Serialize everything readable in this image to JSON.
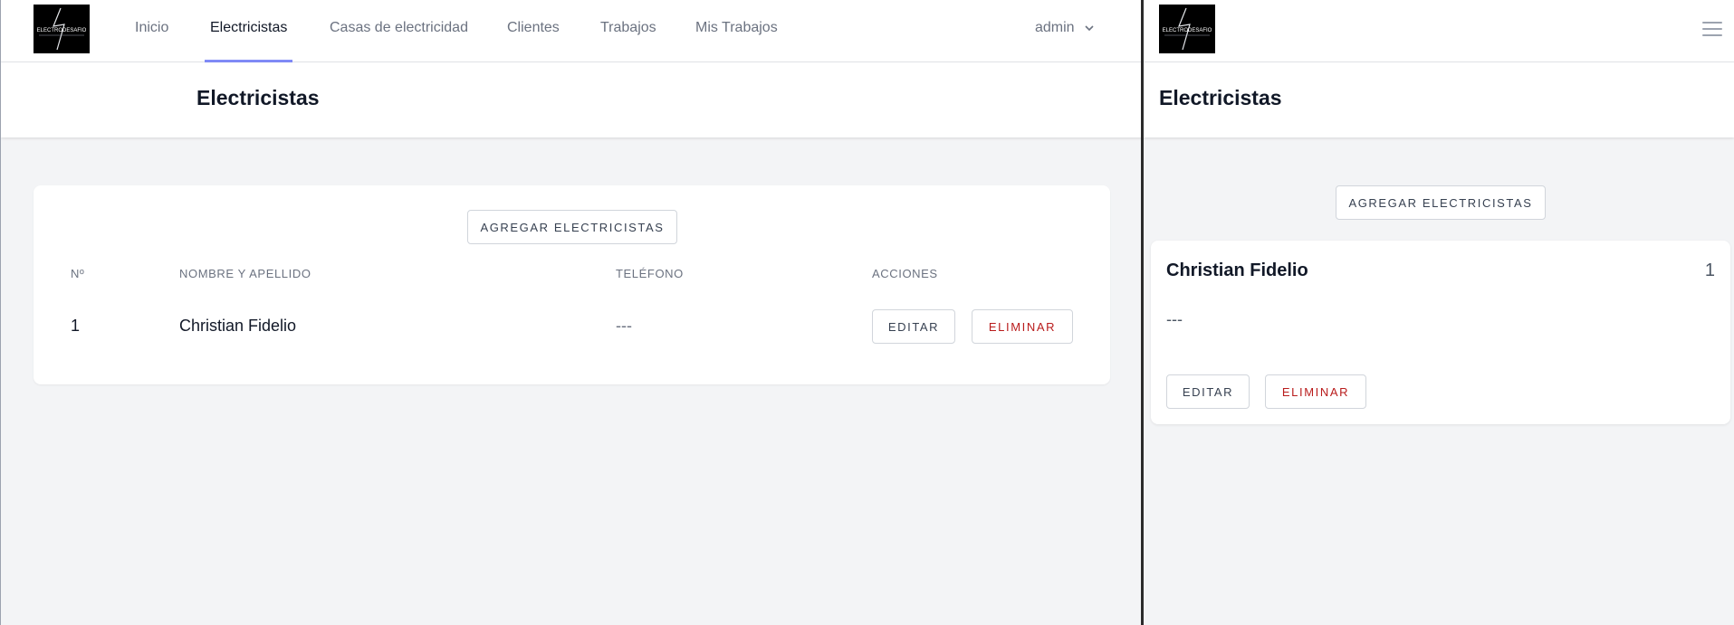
{
  "app": {
    "logo_text": "ELECTRODESAFIO"
  },
  "nav": {
    "items": [
      {
        "label": "Inicio"
      },
      {
        "label": "Electricistas",
        "active": true
      },
      {
        "label": "Casas de electricidad"
      },
      {
        "label": "Clientes"
      },
      {
        "label": "Trabajos"
      },
      {
        "label": "Mis Trabajos"
      }
    ],
    "user": "admin",
    "accent_color": "#818cf8"
  },
  "page": {
    "title": "Electricistas",
    "add_button": "AGREGAR ELECTRICISTAS"
  },
  "table": {
    "columns": [
      "Nº",
      "NOMBRE Y APELLIDO",
      "TELÉFONO",
      "ACCIONES"
    ],
    "rows": [
      {
        "num": "1",
        "name": "Christian Fidelio",
        "phone": "---",
        "edit": "EDITAR",
        "delete": "ELIMINAR"
      }
    ]
  },
  "mobile": {
    "card": {
      "name": "Christian Fidelio",
      "num": "1",
      "phone": "---",
      "edit": "EDITAR",
      "delete": "ELIMINAR"
    }
  },
  "colors": {
    "danger": "#b91c1c",
    "background": "#f3f4f6"
  }
}
